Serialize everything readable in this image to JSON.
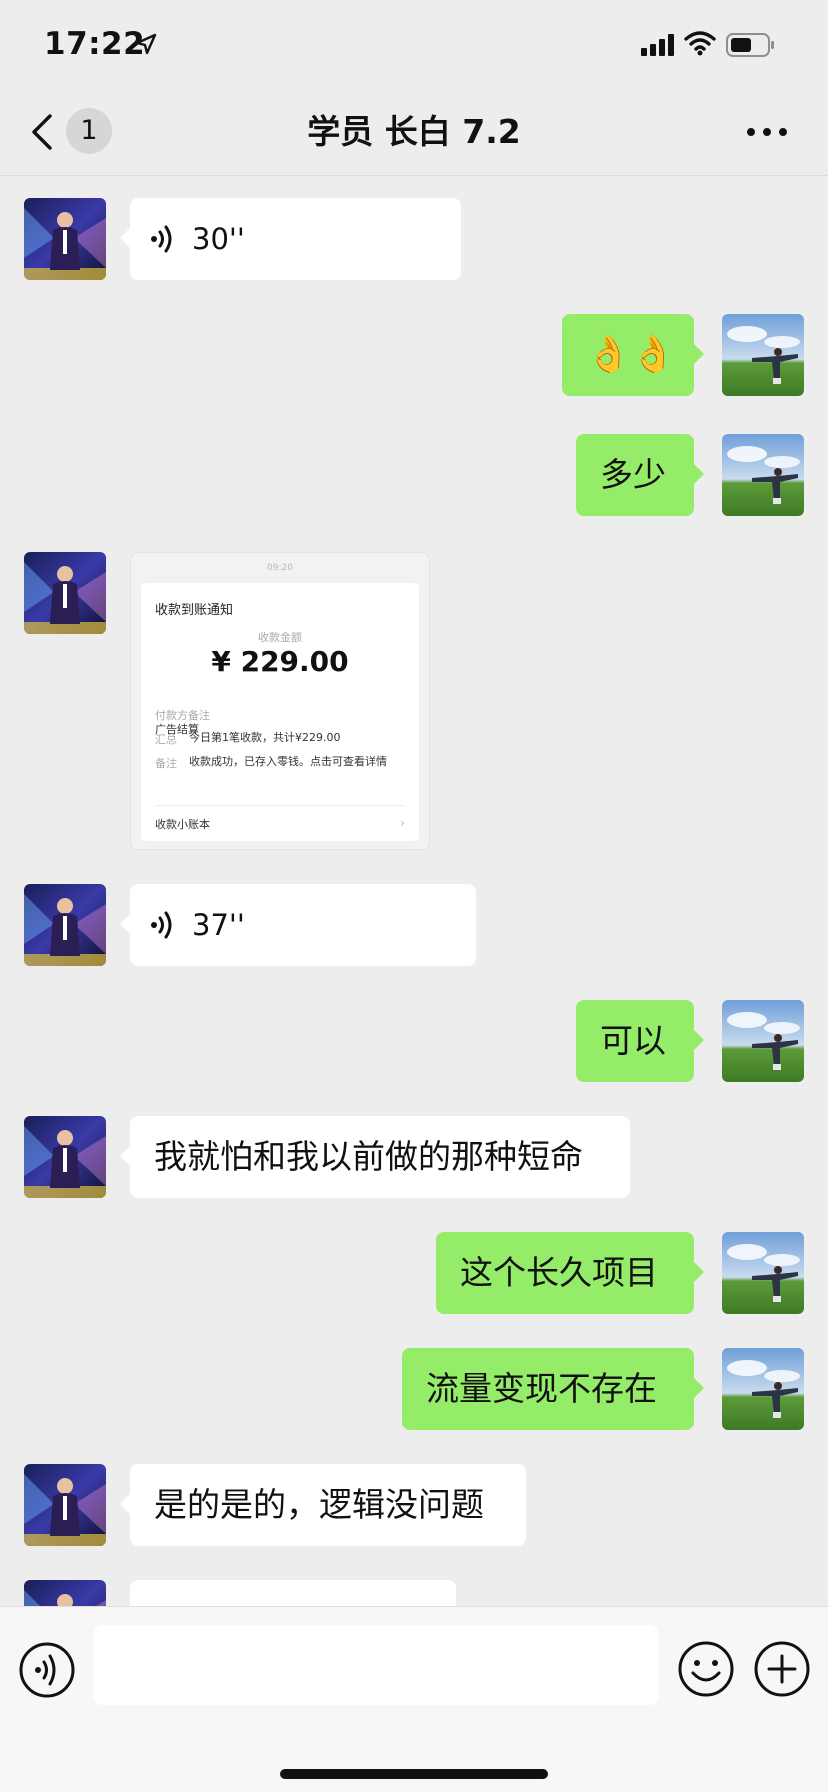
{
  "status_bar": {
    "time": "17:22"
  },
  "nav": {
    "back_badge": "1",
    "title": "学员 长白 7.2"
  },
  "messages": [
    {
      "side": "in",
      "kind": "voice",
      "duration": "30''"
    },
    {
      "side": "out",
      "kind": "text",
      "text": "👌👌"
    },
    {
      "side": "out",
      "kind": "text",
      "text": "多少"
    },
    {
      "side": "in",
      "kind": "image",
      "description": "payment receipt screenshot"
    },
    {
      "side": "in",
      "kind": "voice",
      "duration": "37''"
    },
    {
      "side": "out",
      "kind": "text",
      "text": "可以"
    },
    {
      "side": "in",
      "kind": "text",
      "text": "我就怕和我以前做的那种短命"
    },
    {
      "side": "out",
      "kind": "text",
      "text": "这个长久项目"
    },
    {
      "side": "out",
      "kind": "text",
      "text": "流量变现不存在"
    },
    {
      "side": "in",
      "kind": "text",
      "text": "是的是的，逻辑没问题"
    }
  ],
  "receipt": {
    "top_time": "09:20",
    "heading": "收款到账通知",
    "amount_label": "收款金额",
    "amount": "¥ 229.00",
    "rows": [
      {
        "label": "付款方备注",
        "value": "广告结算"
      },
      {
        "label": "汇总",
        "value": "今日第1笔收款，共计¥229.00"
      },
      {
        "label": "备注",
        "value": "收款成功，已存入零钱。点击可查看详情"
      }
    ],
    "footer": "收款小账本"
  },
  "input": {
    "placeholder": ""
  },
  "colors": {
    "outgoing_bubble": "#95ec69",
    "incoming_bubble": "#ffffff",
    "background": "#ededed"
  }
}
